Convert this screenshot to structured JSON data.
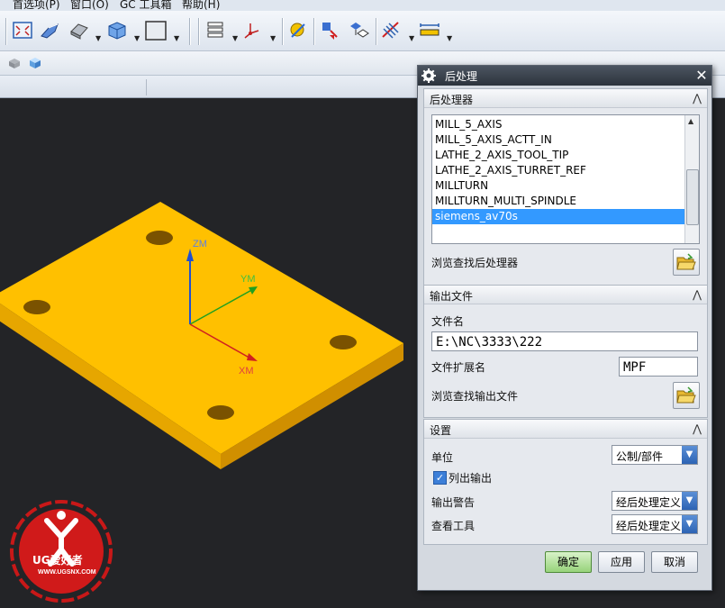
{
  "menubar": {
    "items": [
      "首选项(P)",
      "窗口(O)",
      "GC 工具箱",
      "帮助(H)"
    ]
  },
  "toolbar": {
    "icons": [
      "fit-view-icon",
      "shaded-edges-icon",
      "render-style-icon",
      "orient-view-icon",
      "background-icon",
      "layer-icon",
      "wcs-icon",
      "snap-icon",
      "toolpath-verify-icon",
      "postprocess-icon",
      "shop-doc-icon",
      "measure-icon"
    ]
  },
  "viewport": {
    "axes": {
      "z": "ZM",
      "y": "YM",
      "x": "XM"
    },
    "colors": {
      "plate_top": "#ffc000",
      "plate_side": "#d99a00",
      "axis_z": "#2050d0",
      "axis_y": "#20a020",
      "axis_x": "#d02020"
    },
    "watermark": {
      "brand": "UG爱好者",
      "url": "WWW.UGSNX.COM"
    }
  },
  "dialog": {
    "title": "后处理",
    "postprocessor_group": {
      "header": "后处理器",
      "items": [
        "MILL_5_AXIS",
        "MILL_5_AXIS_ACTT_IN",
        "LATHE_2_AXIS_TOOL_TIP",
        "LATHE_2_AXIS_TURRET_REF",
        "MILLTURN",
        "MILLTURN_MULTI_SPINDLE",
        "siemens_av70s"
      ],
      "selected": "siemens_av70s",
      "browse_label": "浏览查找后处理器"
    },
    "output_group": {
      "header": "输出文件",
      "filename_label": "文件名",
      "filename_value": "E:\\NC\\3333\\222",
      "extension_label": "文件扩展名",
      "extension_value": "MPF",
      "browse_label": "浏览查找输出文件"
    },
    "settings_group": {
      "header": "设置",
      "unit_label": "单位",
      "unit_value": "公制/部件",
      "list_output_label": "列出输出",
      "list_output_checked": true,
      "warning_label": "输出警告",
      "warning_value": "经后处理定义",
      "review_label": "查看工具",
      "review_value": "经后处理定义"
    },
    "buttons": {
      "ok": "确定",
      "apply": "应用",
      "cancel": "取消"
    }
  }
}
